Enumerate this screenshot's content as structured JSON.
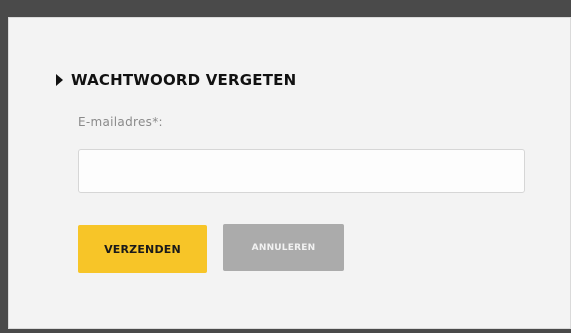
{
  "form": {
    "title": "WACHTWOORD VERGETEN",
    "email_label": "E-mailadres*:",
    "email_value": "",
    "email_placeholder": ""
  },
  "buttons": {
    "submit_label": "VERZENDEN",
    "cancel_label": "ANNULEREN"
  },
  "colors": {
    "submit_bg": "#f7c528",
    "cancel_bg": "#ababab",
    "panel_bg": "#f3f3f3",
    "outer_bg": "#4a4a4a"
  },
  "icons": {
    "heading_marker": "triangle-right-icon"
  }
}
